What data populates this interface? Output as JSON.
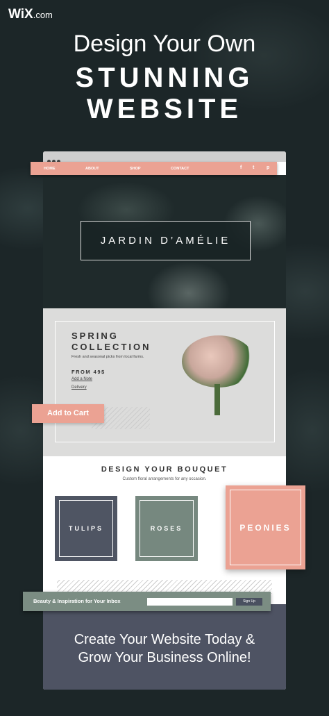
{
  "brand": {
    "logo": "WiX",
    "logo_suffix": ".com"
  },
  "headline": {
    "line1": "Design Your Own",
    "line2": "STUNNING",
    "line3": "WEBSITE"
  },
  "site": {
    "nav": [
      "HOME",
      "ABOUT",
      "SHOP",
      "CONTACT"
    ],
    "social": [
      "f",
      "t",
      "p"
    ],
    "title": "JARDIN D’AMÉLIE",
    "spring": {
      "title1": "SPRING",
      "title2": "COLLECTION",
      "desc": "Fresh and seasonal picks from local farms.",
      "price": "FROM 49$",
      "link1": "Add a Note",
      "link2": "Delivery",
      "cart": "Add to Cart"
    },
    "bouquet": {
      "title": "DESIGN YOUR BOUQUET",
      "subtitle": "Custom floral arrangements for any occasion.",
      "tiles": [
        "TULIPS",
        "ROSES",
        "PEONIES"
      ]
    },
    "newsletter": {
      "label": "Beauty & Inspiration for Your Inbox",
      "input": "",
      "button": "Sign Up"
    }
  },
  "cta": {
    "line1": "Create Your Website Today &",
    "line2": "Grow Your Business Online!"
  },
  "colors": {
    "accent": "#eba293",
    "background": "#1c2628",
    "sage": "#7b8d83",
    "slate": "#4f5563"
  }
}
